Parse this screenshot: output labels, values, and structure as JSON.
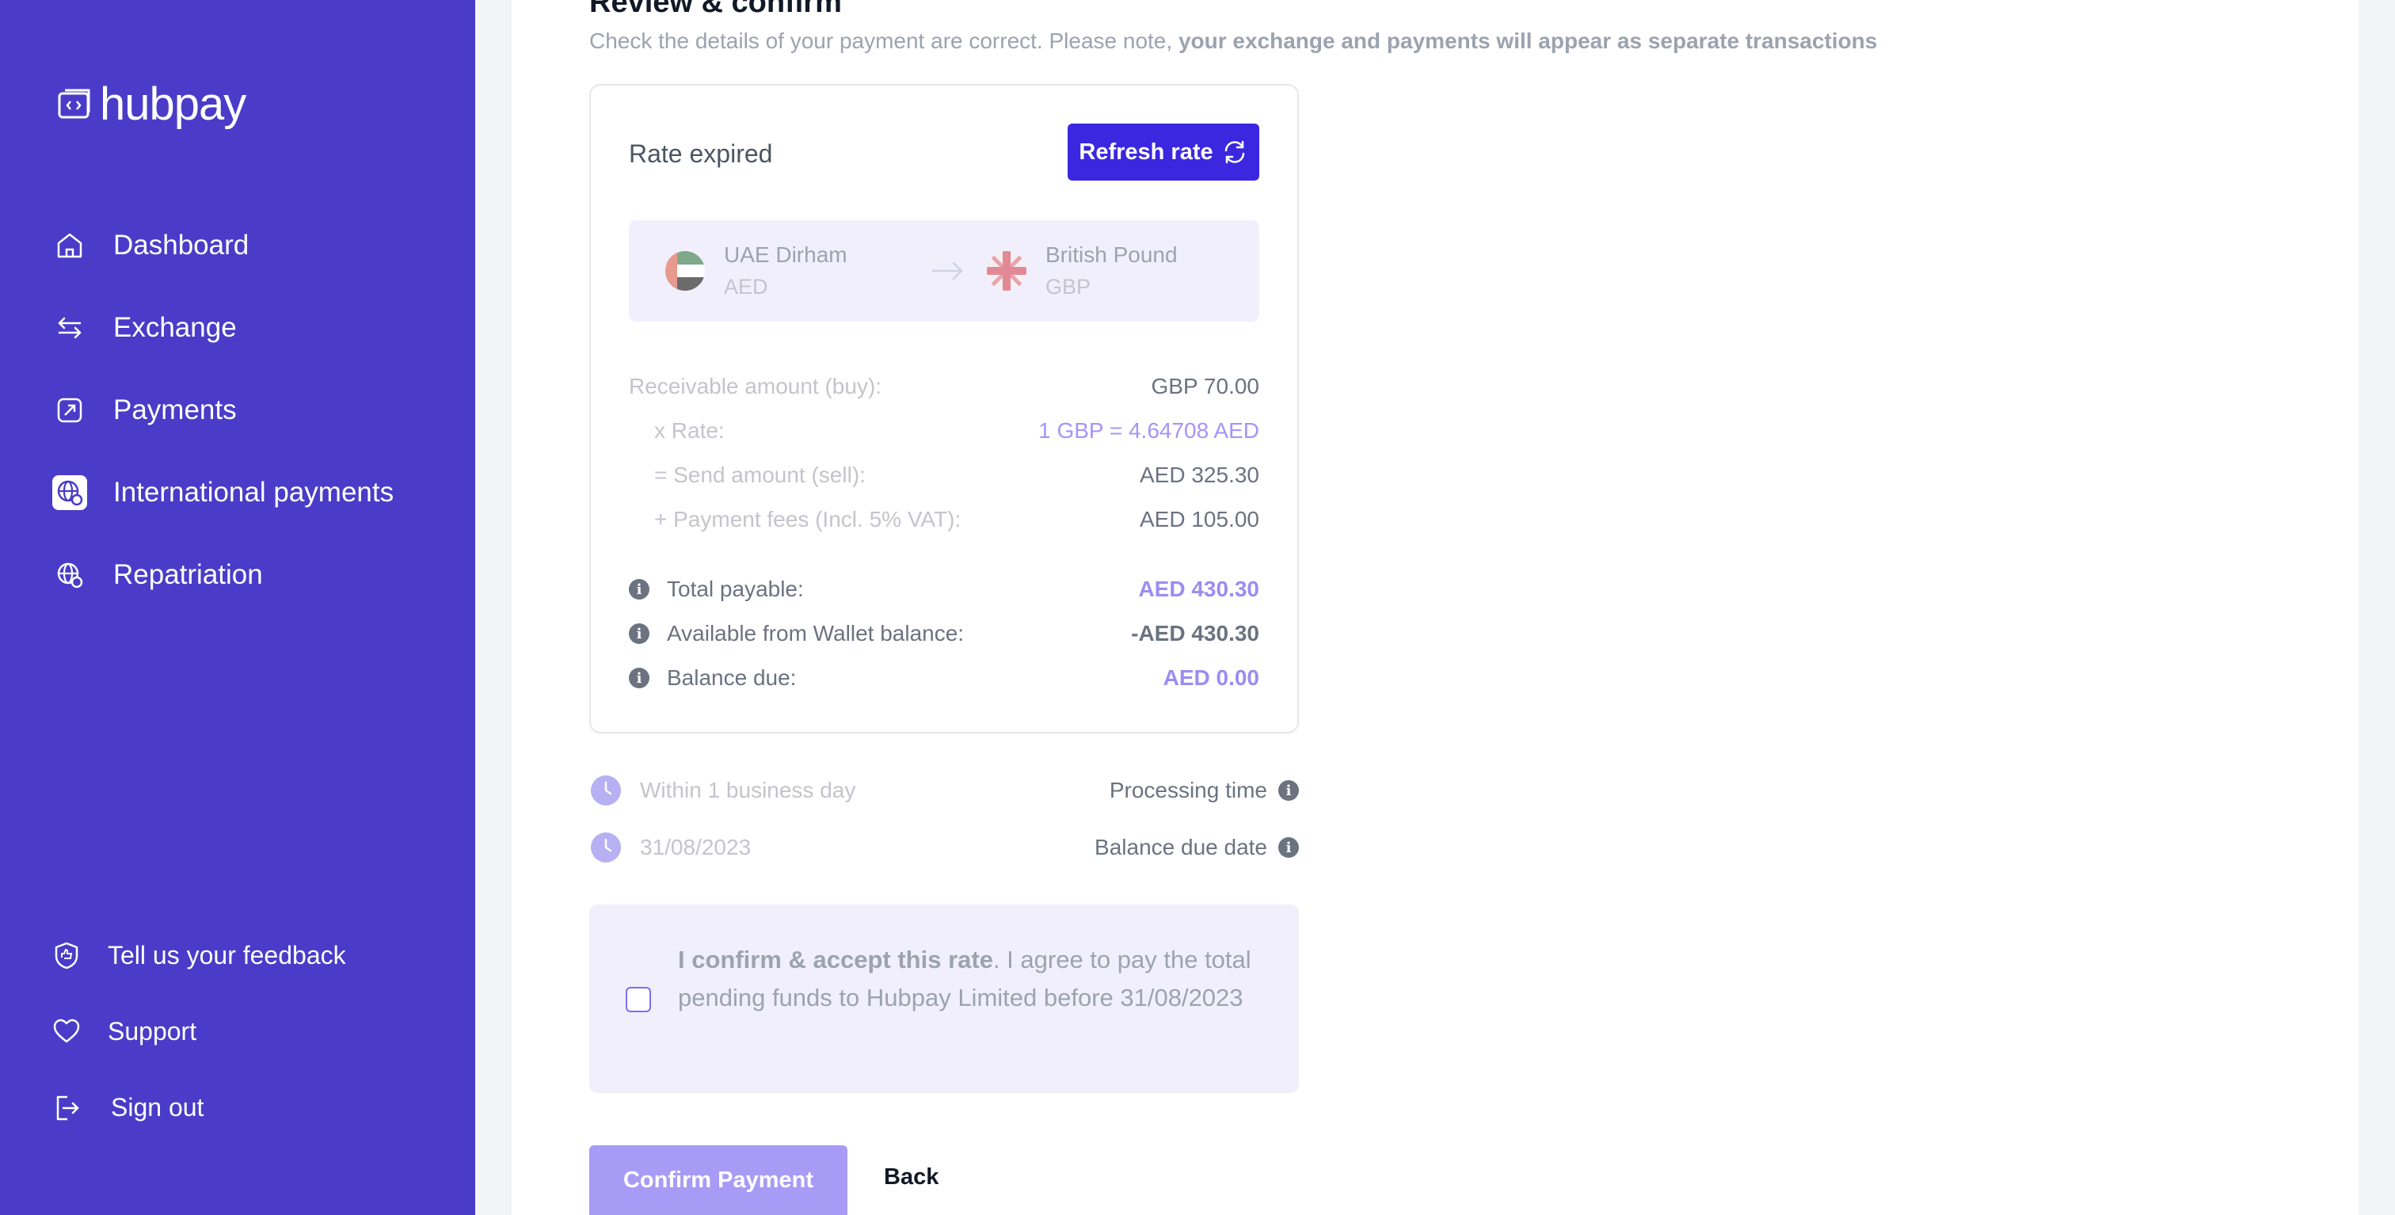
{
  "app": {
    "brand": "hubpay",
    "colors": {
      "sidebar": "#4a3cc8",
      "accent": "#3b27e0",
      "muted_purple": "#a89bf5"
    }
  },
  "sidebar": {
    "items": [
      {
        "label": "Dashboard",
        "icon": "home-icon"
      },
      {
        "label": "Exchange",
        "icon": "swap-arrows-icon"
      },
      {
        "label": "Payments",
        "icon": "payment-icon"
      },
      {
        "label": "International payments",
        "icon": "globe-icon",
        "active": true
      },
      {
        "label": "Repatriation",
        "icon": "globe-icon"
      }
    ],
    "bottom": [
      {
        "label": "Tell us your feedback",
        "icon": "feedback-icon"
      },
      {
        "label": "Support",
        "icon": "heart-icon"
      },
      {
        "label": "Sign out",
        "icon": "sign-out-icon"
      }
    ]
  },
  "main": {
    "title": "Review & confirm",
    "subtitle_plain": "Check the details of your payment are correct. Please note, ",
    "subtitle_bold": "your exchange and payments will appear as separate transactions"
  },
  "card": {
    "rate_status": "Rate expired",
    "refresh_label": "Refresh rate",
    "from": {
      "name": "UAE Dirham",
      "code": "AED"
    },
    "to": {
      "name": "British Pound",
      "code": "GBP"
    },
    "rows": [
      {
        "label": "Receivable amount (buy):",
        "value": "GBP 70.00"
      },
      {
        "label": "x Rate:",
        "value": "1 GBP = 4.64708 AED"
      },
      {
        "label": "= Send amount (sell):",
        "value": "AED 325.30"
      },
      {
        "label": "+ Payment fees (Incl. 5% VAT):",
        "value": "AED 105.00"
      }
    ],
    "totals": [
      {
        "label": "Total payable:",
        "value": "AED 430.30"
      },
      {
        "label": "Available from Wallet balance:",
        "value": "-AED 430.30"
      },
      {
        "label": "Balance due:",
        "value": "AED 0.00"
      }
    ]
  },
  "meta": [
    {
      "left": "Within 1 business day",
      "right": "Processing time"
    },
    {
      "left": "31/08/2023",
      "right": "Balance due date"
    }
  ],
  "confirm": {
    "bold": "I confirm & accept this rate",
    "text": ". I agree to pay the total pending funds to Hubpay Limited before 31/08/2023",
    "checked": false
  },
  "actions": {
    "confirm_label": "Confirm Payment",
    "back_label": "Back"
  }
}
